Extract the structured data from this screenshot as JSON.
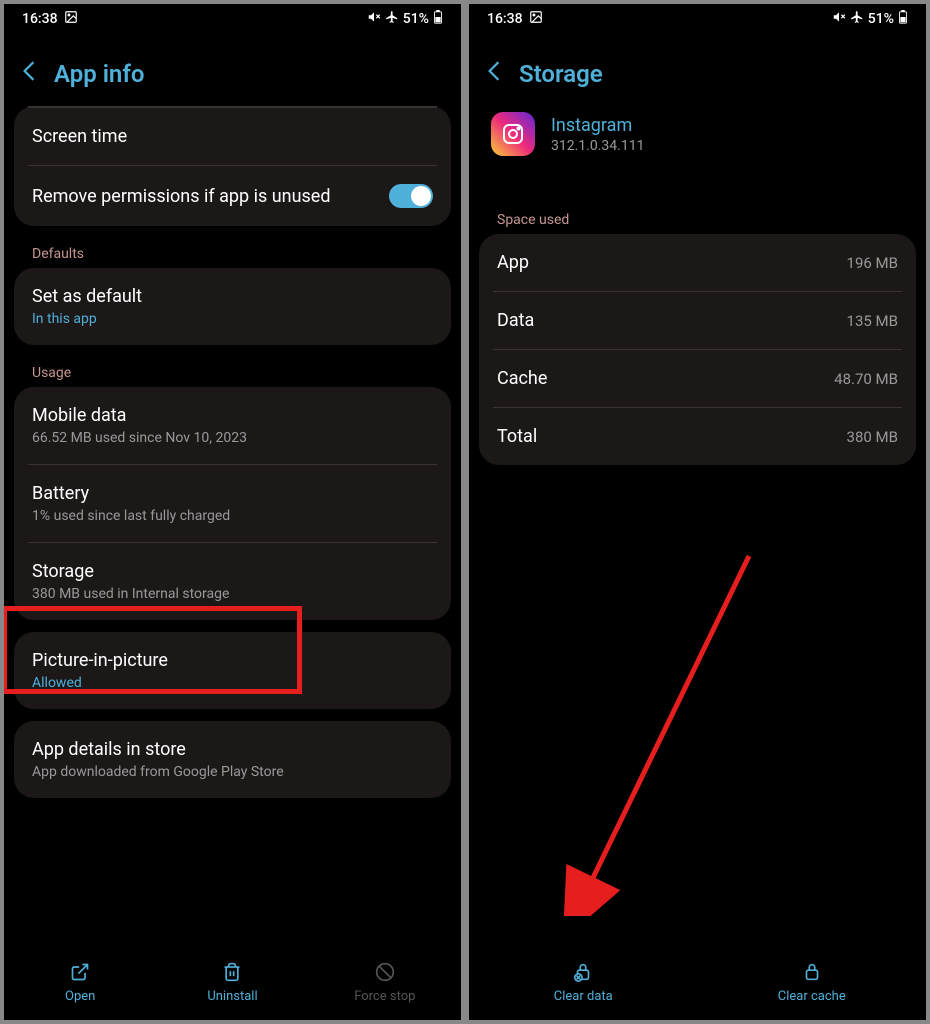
{
  "status": {
    "time": "16:38",
    "battery": "51%"
  },
  "left": {
    "title": "App info",
    "rows": {
      "screen_time": "Screen time",
      "remove_perms": "Remove permissions if app is unused"
    },
    "sections": {
      "defaults_label": "Defaults",
      "set_default": "Set as default",
      "set_default_sub": "In this app",
      "usage_label": "Usage",
      "mobile_data": "Mobile data",
      "mobile_data_sub": "66.52 MB used since Nov 10, 2023",
      "battery": "Battery",
      "battery_sub": "1% used since last fully charged",
      "storage": "Storage",
      "storage_sub": "380 MB used in Internal storage",
      "pip": "Picture-in-picture",
      "pip_sub": "Allowed",
      "app_details": "App details in store",
      "app_details_sub": "App downloaded from Google Play Store"
    },
    "bottom": {
      "open": "Open",
      "uninstall": "Uninstall",
      "force_stop": "Force stop"
    }
  },
  "right": {
    "title": "Storage",
    "app_name": "Instagram",
    "app_version": "312.1.0.34.111",
    "space_used_label": "Space used",
    "rows": {
      "app_label": "App",
      "app_value": "196 MB",
      "data_label": "Data",
      "data_value": "135 MB",
      "cache_label": "Cache",
      "cache_value": "48.70 MB",
      "total_label": "Total",
      "total_value": "380 MB"
    },
    "bottom": {
      "clear_data": "Clear data",
      "clear_cache": "Clear cache"
    }
  }
}
